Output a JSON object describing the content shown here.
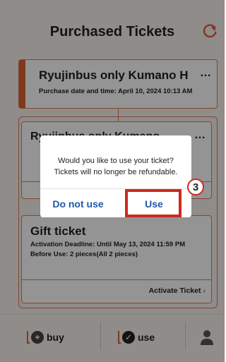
{
  "header": {
    "title": "Purchased Tickets",
    "refresh_icon": "refresh-icon"
  },
  "tickets": [
    {
      "name": "Ryujinbus only Kumano H",
      "more": "…",
      "meta": "Purchase date and time: April 10, 2024 10:13 AM"
    },
    {
      "name": "Ryujinbus only Kumano",
      "more": "…"
    },
    {
      "name": "Gift ticket",
      "meta_line1": "Activation Deadline: Until May 13, 2024 11:59 PM",
      "meta_line2": "Before Use: 2 pieces(All 2 pieces)",
      "action": "Activate Ticket",
      "action_chevron": "›"
    }
  ],
  "dialog": {
    "message": "Would you like to use your ticket? Tickets will no longer be refundable.",
    "cancel_label": "Do not use",
    "confirm_label": "Use"
  },
  "annotation": {
    "step_number": "3",
    "color": "#cc2a1f"
  },
  "bottom_nav": {
    "buy_label": "buy",
    "use_label": "use",
    "active": "use"
  },
  "colors": {
    "accent": "#d9642f",
    "link": "#1e5aa8"
  }
}
